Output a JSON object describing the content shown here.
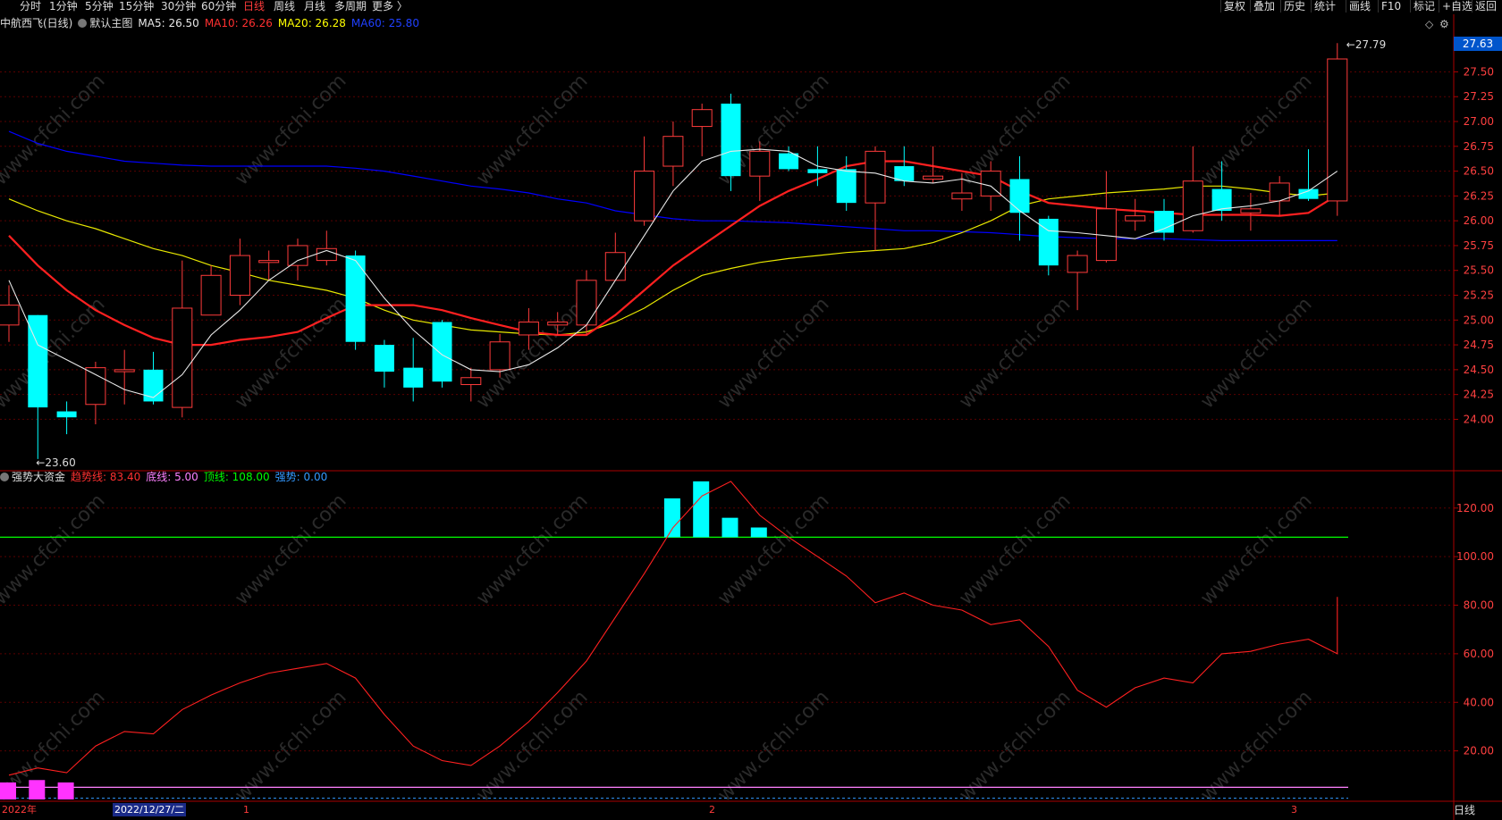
{
  "periods": [
    {
      "label": "分时",
      "active": false
    },
    {
      "label": "1分钟",
      "active": false
    },
    {
      "label": "5分钟",
      "active": false
    },
    {
      "label": "15分钟",
      "active": false
    },
    {
      "label": "30分钟",
      "active": false
    },
    {
      "label": "60分钟",
      "active": false
    },
    {
      "label": "日线",
      "active": true
    },
    {
      "label": "周线",
      "active": false
    },
    {
      "label": "月线",
      "active": false
    },
    {
      "label": "多周期",
      "active": false
    },
    {
      "label": "更多 〉",
      "active": false
    }
  ],
  "right_buttons": [
    "复权",
    "叠加",
    "历史",
    "统计",
    "画线",
    "F10",
    "标记",
    "+自选",
    "返回"
  ],
  "header": {
    "stock": "中航西飞(日线)",
    "main_chart": "默认主图",
    "ma5": "MA5: 26.50",
    "ma10": "MA10: 26.26",
    "ma20": "MA20: 26.28",
    "ma60": "MA60: 25.80"
  },
  "indicator_header": {
    "name": "强势大资金",
    "trend": "趋势线: 83.40",
    "bottom": "底线: 5.00",
    "top": "顶线: 108.00",
    "strength": "强势: 0.00"
  },
  "current_price": "27.63",
  "max_label": "27.79",
  "min_label": "23.60",
  "date_labels": {
    "year": "2022年",
    "cursor": "2022/12/27/二",
    "m1": "1",
    "m2": "2",
    "m3": "3"
  },
  "period_label": "日线",
  "watermark": "www.cfchi.com",
  "colors": {
    "up": "#ff3b3b",
    "down": "#00ffff",
    "ma5": "#e8e8e8",
    "ma10": "#ff2020",
    "ma20": "#e8e800",
    "ma60": "#0000ff",
    "trend": "#ff2020",
    "topline": "#00ff00",
    "bottomline": "#ff80ff",
    "grid": "#5a0000"
  },
  "chart_data": {
    "type": "candlestick",
    "price_axis": {
      "ticks": [
        "27.50",
        "27.25",
        "27.00",
        "26.75",
        "26.50",
        "26.25",
        "26.00",
        "25.75",
        "25.50",
        "25.25",
        "25.00",
        "24.75",
        "24.50",
        "24.25",
        "24.00"
      ],
      "ylim": [
        23.5,
        27.9
      ]
    },
    "indicator_axis": {
      "ticks": [
        "120.00",
        "100.00",
        "80.00",
        "60.00",
        "40.00",
        "20.00"
      ],
      "ylim": [
        0,
        135
      ]
    },
    "candles": [
      {
        "o": 24.95,
        "c": 25.15,
        "h": 25.35,
        "l": 24.78
      },
      {
        "o": 25.05,
        "c": 24.12,
        "h": 25.05,
        "l": 23.6
      },
      {
        "o": 24.08,
        "c": 24.02,
        "h": 24.18,
        "l": 23.85
      },
      {
        "o": 24.15,
        "c": 24.52,
        "h": 24.58,
        "l": 23.95
      },
      {
        "o": 24.48,
        "c": 24.5,
        "h": 24.7,
        "l": 24.15
      },
      {
        "o": 24.5,
        "c": 24.18,
        "h": 24.68,
        "l": 24.15
      },
      {
        "o": 24.12,
        "c": 25.12,
        "h": 25.6,
        "l": 24.02
      },
      {
        "o": 25.05,
        "c": 25.45,
        "h": 25.55,
        "l": 25.05
      },
      {
        "o": 25.25,
        "c": 25.65,
        "h": 25.82,
        "l": 25.15
      },
      {
        "o": 25.58,
        "c": 25.6,
        "h": 25.7,
        "l": 25.4
      },
      {
        "o": 25.55,
        "c": 25.75,
        "h": 25.82,
        "l": 25.4
      },
      {
        "o": 25.6,
        "c": 25.72,
        "h": 25.9,
        "l": 25.55
      },
      {
        "o": 25.65,
        "c": 24.78,
        "h": 25.7,
        "l": 24.7
      },
      {
        "o": 24.75,
        "c": 24.48,
        "h": 24.8,
        "l": 24.32
      },
      {
        "o": 24.52,
        "c": 24.32,
        "h": 24.82,
        "l": 24.18
      },
      {
        "o": 24.98,
        "c": 24.38,
        "h": 25.0,
        "l": 24.32
      },
      {
        "o": 24.35,
        "c": 24.42,
        "h": 24.52,
        "l": 24.18
      },
      {
        "o": 24.5,
        "c": 24.78,
        "h": 24.86,
        "l": 24.42
      },
      {
        "o": 24.85,
        "c": 24.98,
        "h": 25.12,
        "l": 24.7
      },
      {
        "o": 24.95,
        "c": 24.98,
        "h": 25.08,
        "l": 24.85
      },
      {
        "o": 24.95,
        "c": 25.4,
        "h": 25.5,
        "l": 24.85
      },
      {
        "o": 25.4,
        "c": 25.68,
        "h": 25.88,
        "l": 25.4
      },
      {
        "o": 26.0,
        "c": 26.5,
        "h": 26.85,
        "l": 25.95
      },
      {
        "o": 26.55,
        "c": 26.85,
        "h": 27.0,
        "l": 26.35
      },
      {
        "o": 26.95,
        "c": 27.12,
        "h": 27.18,
        "l": 26.65
      },
      {
        "o": 27.18,
        "c": 26.45,
        "h": 27.28,
        "l": 26.3
      },
      {
        "o": 26.45,
        "c": 26.7,
        "h": 26.8,
        "l": 26.2
      },
      {
        "o": 26.68,
        "c": 26.52,
        "h": 26.75,
        "l": 26.5
      },
      {
        "o": 26.52,
        "c": 26.48,
        "h": 26.75,
        "l": 26.35
      },
      {
        "o": 26.52,
        "c": 26.18,
        "h": 26.65,
        "l": 26.1
      },
      {
        "o": 26.18,
        "c": 26.7,
        "h": 26.75,
        "l": 25.7
      },
      {
        "o": 26.55,
        "c": 26.4,
        "h": 26.75,
        "l": 26.35
      },
      {
        "o": 26.42,
        "c": 26.45,
        "h": 26.75,
        "l": 26.38
      },
      {
        "o": 26.22,
        "c": 26.28,
        "h": 26.48,
        "l": 26.1
      },
      {
        "o": 26.25,
        "c": 26.5,
        "h": 26.6,
        "l": 26.1
      },
      {
        "o": 26.42,
        "c": 26.08,
        "h": 26.65,
        "l": 25.8
      },
      {
        "o": 26.02,
        "c": 25.55,
        "h": 26.05,
        "l": 25.45
      },
      {
        "o": 25.48,
        "c": 25.65,
        "h": 25.7,
        "l": 25.1
      },
      {
        "o": 25.6,
        "c": 26.12,
        "h": 26.5,
        "l": 25.58
      },
      {
        "o": 26.0,
        "c": 26.05,
        "h": 26.22,
        "l": 25.9
      },
      {
        "o": 26.1,
        "c": 25.88,
        "h": 26.22,
        "l": 25.8
      },
      {
        "o": 25.9,
        "c": 26.4,
        "h": 26.75,
        "l": 25.88
      },
      {
        "o": 26.32,
        "c": 26.1,
        "h": 26.6,
        "l": 26.0
      },
      {
        "o": 26.08,
        "c": 26.12,
        "h": 26.28,
        "l": 25.9
      },
      {
        "o": 26.2,
        "c": 26.38,
        "h": 26.45,
        "l": 26.05
      },
      {
        "o": 26.32,
        "c": 26.22,
        "h": 26.72,
        "l": 26.2
      },
      {
        "o": 26.2,
        "c": 27.63,
        "h": 27.79,
        "l": 26.05
      }
    ],
    "ma5": [
      25.4,
      24.75,
      24.6,
      24.45,
      24.3,
      24.22,
      24.45,
      24.85,
      25.1,
      25.4,
      25.6,
      25.7,
      25.6,
      25.22,
      24.9,
      24.65,
      24.5,
      24.48,
      24.55,
      24.72,
      24.95,
      25.4,
      25.85,
      26.3,
      26.6,
      26.7,
      26.72,
      26.7,
      26.55,
      26.5,
      26.48,
      26.4,
      26.38,
      26.42,
      26.35,
      26.1,
      25.9,
      25.88,
      25.85,
      25.82,
      25.92,
      26.05,
      26.12,
      26.15,
      26.2,
      26.3,
      26.5
    ],
    "ma10": [
      25.85,
      25.55,
      25.3,
      25.1,
      24.95,
      24.82,
      24.75,
      24.75,
      24.8,
      24.83,
      24.88,
      25.02,
      25.15,
      25.15,
      25.15,
      25.1,
      25.02,
      24.95,
      24.88,
      24.85,
      24.85,
      25.05,
      25.3,
      25.55,
      25.75,
      25.95,
      26.15,
      26.3,
      26.42,
      26.55,
      26.6,
      26.6,
      26.55,
      26.5,
      26.45,
      26.3,
      26.18,
      26.15,
      26.12,
      26.1,
      26.08,
      26.06,
      26.06,
      26.06,
      26.05,
      26.08,
      26.26
    ],
    "ma20": [
      26.22,
      26.1,
      26.0,
      25.92,
      25.82,
      25.72,
      25.65,
      25.55,
      25.48,
      25.4,
      25.35,
      25.3,
      25.22,
      25.1,
      25.0,
      24.95,
      24.9,
      24.88,
      24.86,
      24.85,
      24.88,
      24.98,
      25.12,
      25.3,
      25.45,
      25.52,
      25.58,
      25.62,
      25.65,
      25.68,
      25.7,
      25.72,
      25.78,
      25.88,
      26.0,
      26.15,
      26.22,
      26.25,
      26.28,
      26.3,
      26.32,
      26.35,
      26.35,
      26.32,
      26.28,
      26.25,
      26.28
    ],
    "ma60": [
      26.9,
      26.78,
      26.7,
      26.65,
      26.6,
      26.58,
      26.56,
      26.55,
      26.55,
      26.55,
      26.55,
      26.55,
      26.53,
      26.5,
      26.45,
      26.4,
      26.35,
      26.32,
      26.28,
      26.22,
      26.18,
      26.1,
      26.06,
      26.02,
      26.0,
      26.0,
      25.99,
      25.98,
      25.96,
      25.94,
      25.92,
      25.9,
      25.9,
      25.89,
      25.88,
      25.86,
      25.84,
      25.83,
      25.82,
      25.82,
      25.82,
      25.81,
      25.8,
      25.8,
      25.8,
      25.8,
      25.8
    ],
    "trend": [
      10,
      13,
      11,
      22,
      28,
      27,
      37,
      43,
      48,
      52,
      54,
      56,
      50,
      35,
      22,
      16,
      14,
      22,
      32,
      44,
      57,
      75,
      93,
      112,
      125,
      131,
      117,
      108,
      100,
      92,
      81,
      85,
      80,
      78,
      72,
      74,
      63,
      45,
      38,
      46,
      50,
      48,
      60,
      61,
      64,
      66,
      60,
      83.4
    ],
    "strength_bars": [
      0,
      0,
      0,
      0,
      0,
      0,
      0,
      0,
      0,
      0,
      0,
      0,
      0,
      0,
      0,
      0,
      0,
      0,
      0,
      0,
      0,
      0,
      0,
      124,
      131,
      116,
      112,
      0,
      0,
      0,
      0,
      0,
      0,
      0,
      0,
      0,
      0,
      0,
      0,
      0,
      0,
      0,
      0,
      0,
      0,
      0,
      0
    ],
    "low_bars": [
      7,
      8,
      7
    ],
    "top_line": 108,
    "bottom_line": 5
  }
}
